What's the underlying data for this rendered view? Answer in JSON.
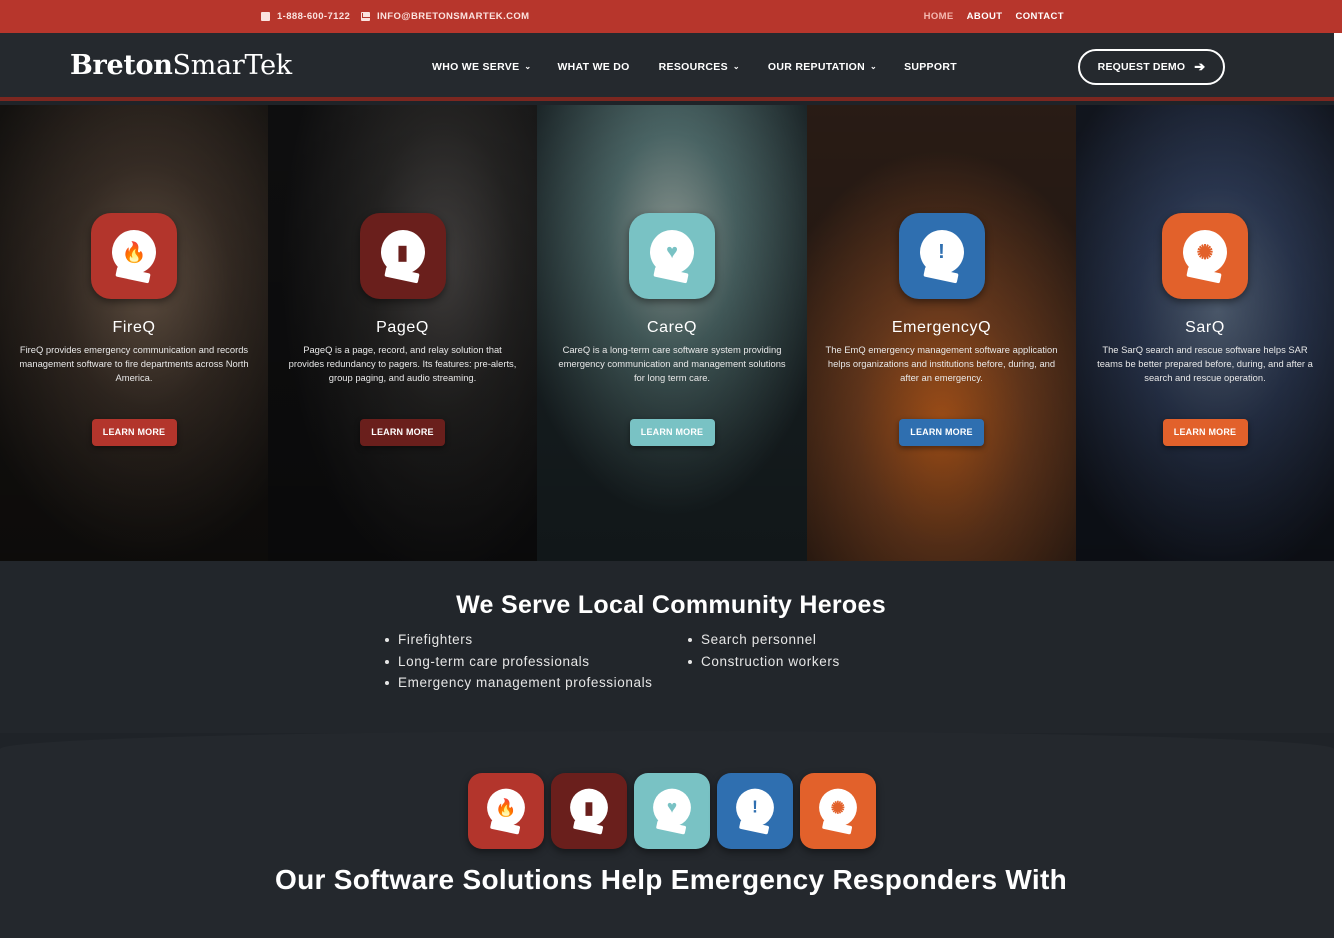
{
  "topbar": {
    "phone": "1-888-600-7122",
    "email": "INFO@BRETONSMARTEK.COM",
    "links": [
      "HOME",
      "ABOUT",
      "CONTACT"
    ]
  },
  "header": {
    "logo_bold": "Breton",
    "logo_light": "SmarTek",
    "nav": [
      {
        "label": "WHO WE SERVE",
        "dropdown": true
      },
      {
        "label": "WHAT WE DO",
        "dropdown": false
      },
      {
        "label": "RESOURCES",
        "dropdown": true
      },
      {
        "label": "OUR REPUTATION",
        "dropdown": true
      },
      {
        "label": "SUPPORT",
        "dropdown": false
      }
    ],
    "cta": "REQUEST DEMO"
  },
  "products": [
    {
      "name": "FireQ",
      "desc": "FireQ provides emergency communication and records management software to fire departments across North America.",
      "button": "LEARN MORE",
      "color": "#b3352c",
      "icon": "flame-icon",
      "glyph": "🔥"
    },
    {
      "name": "PageQ",
      "desc": "PageQ is a page, record, and relay solution that provides redundancy to pagers. Its features: pre-alerts, group paging, and audio streaming.",
      "button": "LEARN MORE",
      "color": "#6a1f1c",
      "icon": "pager-icon",
      "glyph": "▮"
    },
    {
      "name": "CareQ",
      "desc": "CareQ is a long-term care software system providing emergency communication and management solutions for long term care.",
      "button": "LEARN MORE",
      "color": "#79c2c4",
      "icon": "heartbeat-icon",
      "glyph": "♥"
    },
    {
      "name": "EmergencyQ",
      "desc": "The EmQ emergency management software application helps organizations and institutions before, during, and after an emergency.",
      "button": "LEARN MORE",
      "color": "#2f6fb0",
      "icon": "warning-icon",
      "glyph": "!"
    },
    {
      "name": "SarQ",
      "desc": "The SarQ search and rescue software helps SAR teams be better prepared before, during, and after a search and rescue operation.",
      "button": "LEARN MORE",
      "color": "#e2612b",
      "icon": "compass-icon",
      "glyph": "✺"
    }
  ],
  "heroes": {
    "title": "We Serve Local Community Heroes",
    "col1": [
      "Firefighters",
      "Long-term care professionals",
      "Emergency management professionals"
    ],
    "col2": [
      "Search personnel",
      "Construction workers"
    ]
  },
  "solutions": {
    "title": "Our Software Solutions Help Emergency Responders With"
  }
}
